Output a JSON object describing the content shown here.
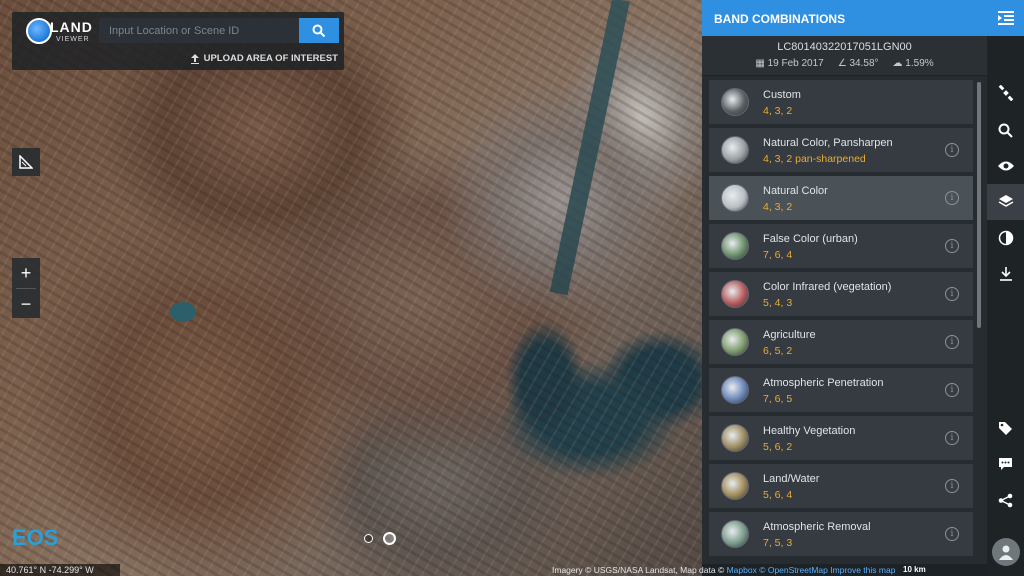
{
  "app": {
    "logo_text": "LAND",
    "logo_sub": "VIEWER"
  },
  "search": {
    "placeholder": "Input Location or Scene ID",
    "upload_label": "UPLOAD AREA OF INTEREST"
  },
  "map": {
    "coords": "40.761° N -74.299° W",
    "attribution_prefix": "Imagery © USGS/NASA Landsat, Map data ©",
    "attribution_links": [
      "Mapbox",
      "© OpenStreetMap",
      "Improve this map"
    ],
    "scale": "10 km",
    "zoom_in": "+",
    "zoom_out": "−",
    "eos": "EOS"
  },
  "panel": {
    "title": "BAND COMBINATIONS",
    "scene_id": "LC80140322017051LGN00",
    "date": "19 Feb 2017",
    "sun_angle": "34.58°",
    "cloud": "1.59%"
  },
  "bands": [
    {
      "name": "Custom",
      "value": "4, 3, 2",
      "thumb": "#5a5f63",
      "info": false,
      "selected": false
    },
    {
      "name": "Natural Color, Pansharpen",
      "value": "4, 3, 2 pan-sharpened",
      "thumb": "#9aa0a4",
      "info": true,
      "selected": false
    },
    {
      "name": "Natural Color",
      "value": "4, 3, 2",
      "thumb": "#b9bec2",
      "info": true,
      "selected": true
    },
    {
      "name": "False Color (urban)",
      "value": "7, 6, 4",
      "thumb": "#6b8f6a",
      "info": true,
      "selected": false
    },
    {
      "name": "Color Infrared (vegetation)",
      "value": "5, 4, 3",
      "thumb": "#b55a5a",
      "info": true,
      "selected": false
    },
    {
      "name": "Agriculture",
      "value": "6, 5, 2",
      "thumb": "#7c9a6a",
      "info": true,
      "selected": false
    },
    {
      "name": "Atmospheric Penetration",
      "value": "7, 6, 5",
      "thumb": "#6a86b8",
      "info": true,
      "selected": false
    },
    {
      "name": "Healthy Vegetation",
      "value": "5, 6, 2",
      "thumb": "#9a8a5e",
      "info": true,
      "selected": false
    },
    {
      "name": "Land/Water",
      "value": "5, 6, 4",
      "thumb": "#a08a5a",
      "info": true,
      "selected": false
    },
    {
      "name": "Atmospheric Removal",
      "value": "7, 5, 3",
      "thumb": "#7a9a8a",
      "info": true,
      "selected": false
    }
  ],
  "colors": {
    "accent": "#2f8fe0",
    "band_value": "#f0a933"
  }
}
